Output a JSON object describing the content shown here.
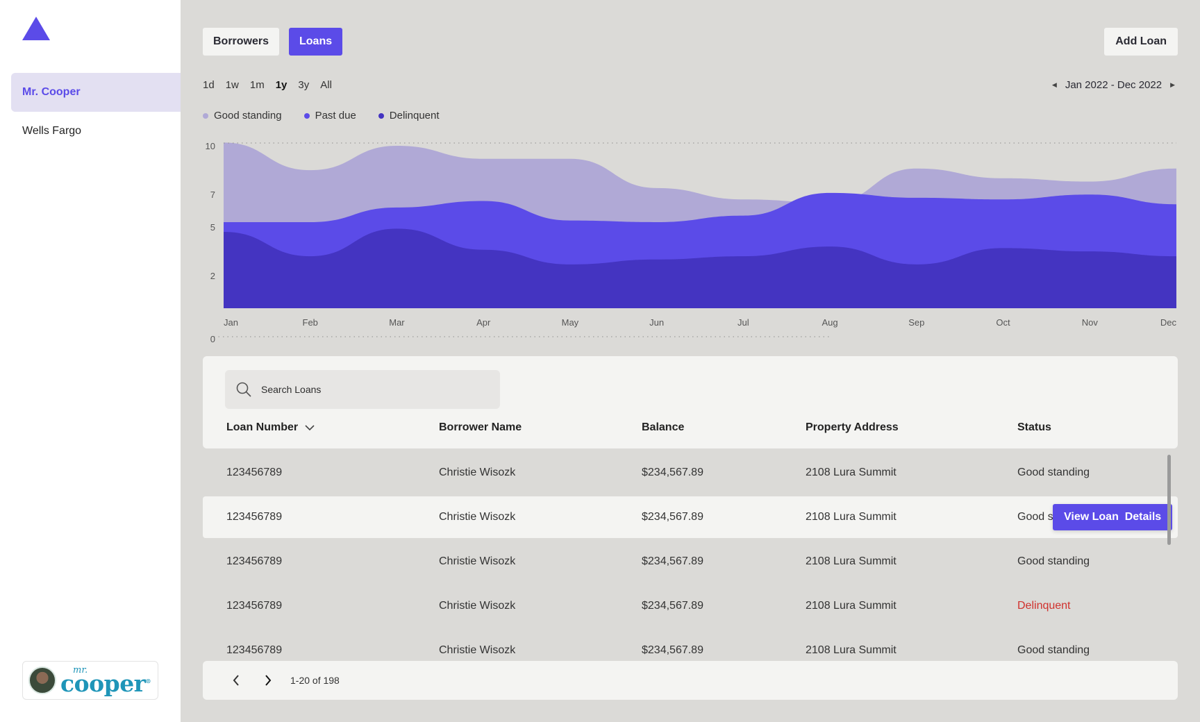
{
  "colors": {
    "accent": "#5b4be8",
    "good": "#b0a9d6",
    "past_due": "#5b4be8",
    "delinquent": "#4434c1",
    "danger": "#d0312d"
  },
  "sidebar": {
    "items": [
      {
        "label": "Mr. Cooper",
        "active": true
      },
      {
        "label": "Wells Fargo",
        "active": false
      }
    ],
    "brand": {
      "mr": "mr.",
      "cooper": "cooper",
      "reg": "®"
    }
  },
  "header": {
    "tabs": [
      {
        "label": "Borrowers",
        "active": false
      },
      {
        "label": "Loans",
        "active": true
      }
    ],
    "add_label": "Add Loan"
  },
  "ranges": [
    "1d",
    "1w",
    "1m",
    "1y",
    "3y",
    "All"
  ],
  "selected_range": "1y",
  "date_range": "Jan 2022 - Dec 2022",
  "legend": [
    "Good standing",
    "Past due",
    "Delinquent"
  ],
  "chart_data": {
    "type": "area",
    "stacked": true,
    "x": [
      "Jan",
      "Feb",
      "Mar",
      "Apr",
      "May",
      "Jun",
      "Jul",
      "Aug",
      "Sep",
      "Oct",
      "Nov",
      "Dec"
    ],
    "y_ticks": [
      0,
      2,
      5,
      7,
      10
    ],
    "ylim": [
      0,
      10
    ],
    "series": [
      {
        "name": "Delinquent",
        "values": [
          4.7,
          3.2,
          4.9,
          3.6,
          2.7,
          3.0,
          3.2,
          3.8,
          2.7,
          3.7,
          3.5,
          3.2
        ]
      },
      {
        "name": "Past due",
        "values": [
          0.6,
          2.1,
          1.3,
          3.0,
          2.7,
          2.3,
          2.5,
          3.3,
          4.1,
          3.0,
          3.5,
          3.2
        ]
      },
      {
        "name": "Good standing",
        "values": [
          4.9,
          3.2,
          3.8,
          2.6,
          3.8,
          2.1,
          1.0,
          -0.6,
          1.8,
          1.3,
          0.8,
          2.2
        ]
      }
    ],
    "grid": "dotted-top-and-bottom",
    "legend_position": "top-left"
  },
  "search": {
    "placeholder": "Search Loans"
  },
  "table": {
    "columns": [
      "Loan Number",
      "Borrower Name",
      "Balance",
      "Property Address",
      "Status"
    ],
    "rows": [
      {
        "loan": "123456789",
        "name": "Christie Wisozk",
        "balance": "$234,567.89",
        "address": "2108 Lura Summit",
        "status": "Good standing"
      },
      {
        "loan": "123456789",
        "name": "Christie Wisozk",
        "balance": "$234,567.89",
        "address": "2108 Lura Summit",
        "status": "Good s"
      },
      {
        "loan": "123456789",
        "name": "Christie Wisozk",
        "balance": "$234,567.89",
        "address": "2108 Lura Summit",
        "status": "Good standing"
      },
      {
        "loan": "123456789",
        "name": "Christie Wisozk",
        "balance": "$234,567.89",
        "address": "2108 Lura Summit",
        "status": "Delinquent"
      },
      {
        "loan": "123456789",
        "name": "Christie Wisozk",
        "balance": "$234,567.89",
        "address": "2108 Lura Summit",
        "status": "Good standing"
      }
    ],
    "hover_action": "View Loan  Details"
  },
  "pagination": {
    "label": "1-20 of 198"
  }
}
